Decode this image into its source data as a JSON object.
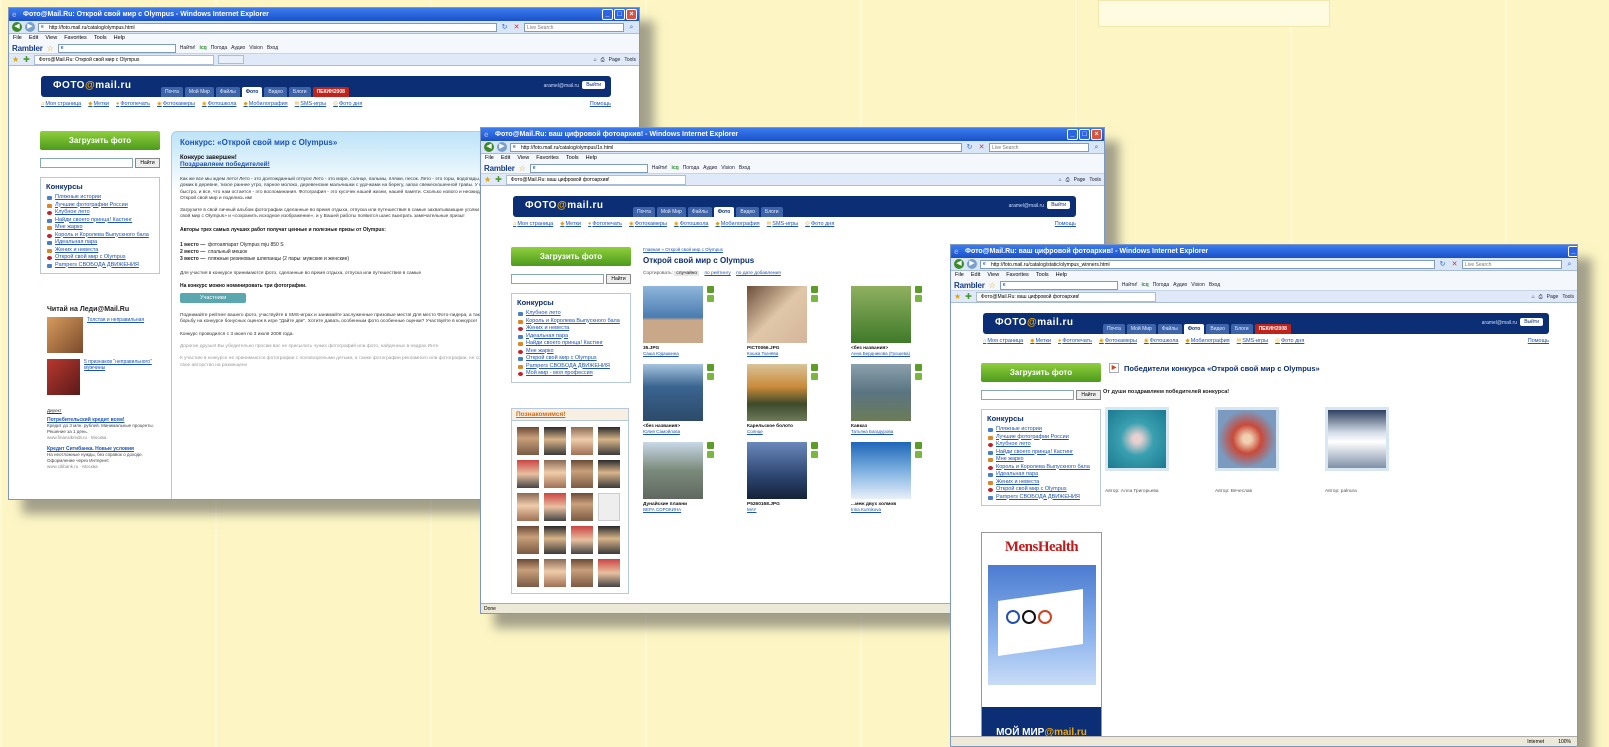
{
  "windows": [
    {
      "title": "Фото@Mail.Ru: Открой свой мир с Olympus - Windows Internet Explorer",
      "url": "http://foto.mail.ru/catalog/olympus.html",
      "search_placeholder": "Live Search",
      "tab_label": "Фото@Mail.Ru: Открой свой мир с Olympus"
    },
    {
      "title": "Фото@Mail.Ru: ваш цифровой фотоархив! - Windows Internet Explorer",
      "url": "http://foto.mail.ru/catalog/olympus/1x.html",
      "search_placeholder": "Live Search",
      "tab_label": "Фото@Mail.Ru: ваш цифровой фотоархив!"
    },
    {
      "title": "Фото@Mail.Ru: ваш цифровой фотоархив! - Windows Internet Explorer",
      "url": "http://foto.mail.ru/catalog/static/olympus_winners.html",
      "search_placeholder": "Live Search",
      "tab_label": "Фото@Mail.Ru: ваш цифровой фотоархив!"
    }
  ],
  "browser": {
    "menu": [
      "File",
      "Edit",
      "View",
      "Favorites",
      "Tools",
      "Help"
    ],
    "rambler": "Rambler",
    "toolbar": [
      "Найти!",
      "Погода",
      "Аудио",
      "Vision",
      "Вход"
    ],
    "icq": "icq",
    "tools": [
      "Page",
      "Tools"
    ],
    "status_done": "Done",
    "status_zone": "Internet",
    "status_zoom": "100%"
  },
  "site": {
    "logo_text": "ФОТО",
    "logo_at": "@",
    "logo_brand": "mail.ru",
    "topnav": [
      "Почта",
      "Мой Мир",
      "Файлы",
      "Фото",
      "Видео",
      "Блоги",
      "ПЕКИН2008"
    ],
    "user_email": "aramel@mail.ru",
    "exit": "Выйти",
    "subnav": [
      "Моя страница",
      "Метки",
      "Фотопечать",
      "Фотокамеры",
      "Фотошкола",
      "Мобилография",
      "SMS-игры",
      "Фото дня"
    ],
    "help": "Помощь",
    "upload": "Загрузить фото",
    "search_btn": "Найти",
    "contests_title": "Конкурсы",
    "contests_w1": [
      "Пляжные истории",
      "Лучшие фотографии России",
      "Клубное лето",
      "Найди своего принца! Кастинг",
      "Мне жарко",
      "Король и Королева Выпускного бала",
      "Идеальная пара",
      "Жених и невеста",
      "Открой свой мир с Olympus",
      "Pampers СВОБОДА ДВИЖЕНИЯ"
    ],
    "contests_w2": [
      "Клубное лето",
      "Король и Королева Выпускного бала",
      "Жених и невеста",
      "Идеальная пара",
      "Найди своего принца! Кастинг",
      "Мне жарко",
      "Открой свой мир с Olympus",
      "Pampers СВОБОДА ДВИЖЕНИЯ",
      "Мой мир - моя профессия"
    ],
    "contests_w3": [
      "Пляжные истории",
      "Лучшие фотографии России",
      "Клубное лето",
      "Найди своего принца! Кастинг",
      "Мне жарко",
      "Король и Королева Выпускного бала",
      "Идеальная пара",
      "Жених и невеста",
      "Открой свой мир с Olympus",
      "Pampers СВОБОДА ДВИЖЕНИЯ"
    ]
  },
  "page1": {
    "title": "Конкурс: «Открой свой мир с Olympus»",
    "finished": "Конкурс завершен!",
    "congrats_link": "Поздравляем победителей!",
    "para1": "Как же все мы ждем лето! Лето - это долгожданный отпуск! Лето - это море, солнце, пальмы, пляжи, песок. Лето - это горы, водопады, сплавы подводный мир, дельфины, русалки. Лето - это маленький домик в деревне, тихое раннее утро, парное молоко, деревенские мальчишки с удочками на берегу, запах свежескошенной травы. У каждого свои ожидания, ассоциации и свой мир. Время пролетает быстро, и все, что нам остается - это воспоминания. Фотография - это кусочек нашей жизни, нашей памяти. Сколько нового и неожиданного можно увидеть, отправляясь на отдых с фотоаппаратом. Открой свой мир и поделись им!",
    "para2": "Загрузите в свой личный альбом фотографии сделанные во время отдыха, отпуска или путешествия в самые захватывающие уголки планеты. При загрузке укажите «номинировать на конкурс «Открой свой мир с Olympus» и «сохранить исходное изображение», и у Вашей работы появится шанс выиграть замечательные призы!",
    "prizes_heading": "Авторы трех самых лучших работ получат ценные и полезные призы от Olympus:",
    "prizes": [
      {
        "place": "1 место —",
        "prize": "фотоаппарат Olympus mju 850 S"
      },
      {
        "place": "2 место —",
        "prize": "спальный мешок"
      },
      {
        "place": "3 место —",
        "prize": "пляжные резиновые шлепанцы (2 пары: мужские и женские)"
      }
    ],
    "para3": "Для участия в конкурсе принимаются фото, сделанные во время отдыха, отпуска или путешествия в самые",
    "nominate": "На конкурс можно номинировать три фотографии.",
    "participants": "Участники",
    "para4": "Поднимайте рейтинг вашего фото, участвуйте в SMS-играх и занимайте заслуженные призовые места! Для место Фото-лидера, а также разместить фото в SMS-topе. Спешите пройти вступить в борьбу на конкурсе бонусных оценок в игре \"Дайте две\". Хотите давать особенным фото особенные оценки? Участвуйте в конкурсе!",
    "dates": "Конкурс проводился с 3 июня по 3 июля 2008 года.",
    "friends": "Дорогие друзья! Вы убедительно просим вас не присылать чужих фотографий или фото, найденных в недрах Инте",
    "note": "К участию в конкурсе не принимаются фотографии с половозрелыми детьми, а также фотографии рекламного или фотографии, не соответствующие текущей теме. Участники конкурса гарантируют свое авторство на размещенн",
    "read_lady": "Читай на Леди@Mail.Ru",
    "lady_items": [
      "Толстая и неправильная",
      "5 признаков \"неправильного\" мужчины"
    ],
    "ads_label": "Директ",
    "ads": [
      {
        "t": "Потребительский кредит всем!",
        "d": "Кредит до 3 млн. рублей. Минимальные проценты. Решение за 1 день.",
        "u": "www.finansikredit.ru · Москва"
      },
      {
        "t": "Кредит Ситибанка. Новые условия",
        "d": "На неотложные нужды, без справок о доходе. Оформление через Интернет.",
        "u": "www.citibank.ru · Москва"
      }
    ]
  },
  "page2": {
    "crumb": "Главная » Открой свой мир с Olympus",
    "title": "Открой свой мир с Olympus",
    "sort_label": "Сортировать:",
    "sort_cur": "случайно",
    "sort_opts": [
      "по рейтингу",
      "по дате добавления"
    ],
    "photos": [
      {
        "name": "35.JPG",
        "author": "Саша Юдашкина"
      },
      {
        "name": "PICT0066.JPG",
        "author": "Кошка Ткачёва"
      },
      {
        "name": "<без названия>",
        "author": "Анна Бердникова (Грошева)"
      },
      {
        "name": "<без названия>",
        "author": "Юлия Самойлова"
      },
      {
        "name": "Карельское болото",
        "author": "Солнце"
      },
      {
        "name": "Кавказ",
        "author": "Татьяна Багадурова"
      },
      {
        "name": "Дунайские плавни",
        "author": "ВЕРА СОРОКИНА"
      },
      {
        "name": "P5260168.JPG",
        "author": "MAY"
      },
      {
        "name": "...меж двух холмов",
        "author": "Irina Kurnikova"
      }
    ],
    "meet": "Познакомимся!"
  },
  "page3": {
    "title": "Победители конкурса «Открой свой мир с Olympus»",
    "congrats": "От души поздравляем победителей конкурса!",
    "winners": [
      "Автор: Алла Григорьева",
      "Автор: Вячеслав",
      "Автор: palnura"
    ],
    "mh_title": "MensHealth",
    "mh_bottom_1": "МОЙ МИР",
    "mh_bottom_2": "@mail.ru"
  }
}
